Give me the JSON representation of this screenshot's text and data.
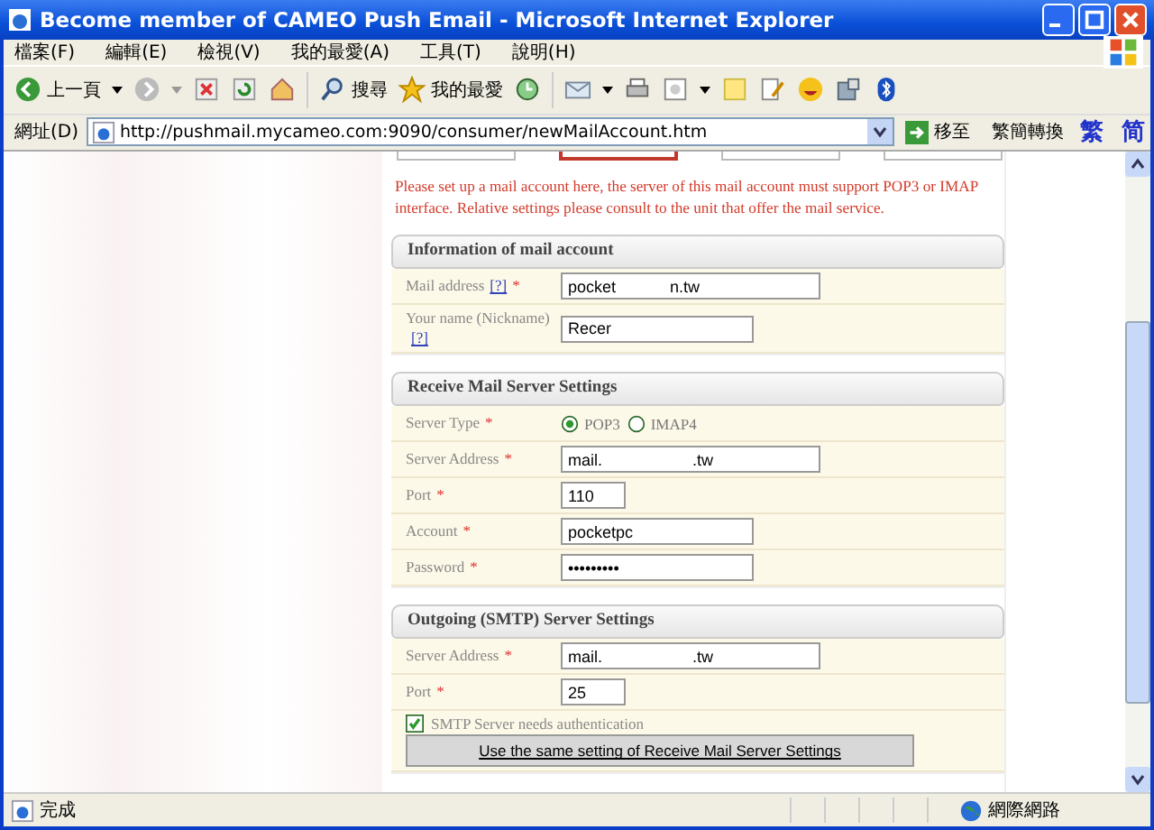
{
  "window": {
    "title": "Become member of CAMEO Push Email - Microsoft Internet Explorer"
  },
  "menu": [
    "檔案(F)",
    "編輯(E)",
    "檢視(V)",
    "我的最愛(A)",
    "工具(T)",
    "說明(H)"
  ],
  "toolbar": {
    "back": "上一頁",
    "search": "搜尋",
    "favorites": "我的最愛"
  },
  "address_bar": {
    "label": "網址(D)",
    "url": "http://pushmail.mycameo.com:9090/consumer/newMailAccount.htm",
    "go": "移至",
    "convert": "繁簡轉換",
    "traditional": "繁",
    "simplified": "简"
  },
  "tabs": [
    {
      "selected": false
    },
    {
      "selected": true
    },
    {
      "selected": false
    },
    {
      "selected": false
    }
  ],
  "intro": "Please set up a mail account here, the server of this mail account must support POP3 or IMAP interface. Relative settings please consult to the unit that offer the mail service.",
  "sections": [
    {
      "title": "Information of mail account",
      "rows": [
        {
          "kind": "field",
          "label": "Mail address",
          "help": "[?]",
          "mark": "*",
          "value": "pocket            n.tw"
        },
        {
          "kind": "field",
          "label": "Your name (Nickname)",
          "help": "[?]",
          "value": "Recer"
        }
      ]
    },
    {
      "title": "Receive Mail Server Settings",
      "rows": [
        {
          "kind": "radio",
          "label": "Server Type",
          "mark": "*",
          "options": [
            {
              "label": "POP3",
              "selected": true
            },
            {
              "label": "IMAP4",
              "selected": false
            }
          ]
        },
        {
          "kind": "field",
          "label": "Server Address",
          "mark": "*",
          "value": "mail.                    .tw"
        },
        {
          "kind": "field",
          "label": "Port",
          "mark": "*",
          "value": "110"
        },
        {
          "kind": "field",
          "label": "Account",
          "mark": "*",
          "value": "pocketpc"
        },
        {
          "kind": "field",
          "label": "Password",
          "mark": "*",
          "value": "•••••••••"
        }
      ]
    },
    {
      "title": "Outgoing (SMTP) Server Settings",
      "rows": [
        {
          "kind": "field",
          "label": "Server Address",
          "mark": "*",
          "value": "mail.                    .tw"
        },
        {
          "kind": "field",
          "label": "Port",
          "mark": "*",
          "value": "25"
        },
        {
          "kind": "checkbox",
          "label": "SMTP Server needs authentication",
          "checked": true,
          "button": "Use the same setting of Receive Mail Server Settings"
        }
      ]
    }
  ],
  "status_bar": {
    "text": "完成",
    "zone": "網際網路"
  }
}
